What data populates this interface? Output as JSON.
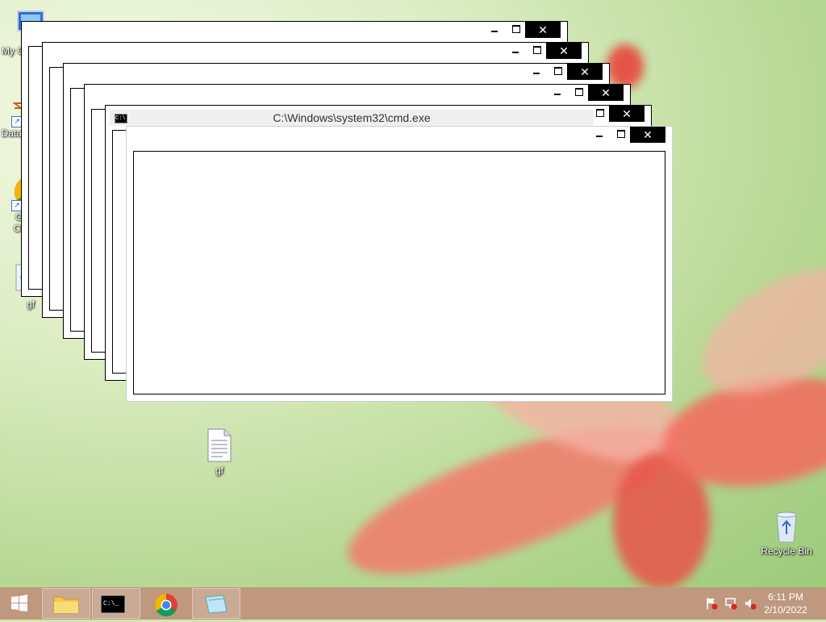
{
  "desktop": {
    "icons": [
      {
        "label": "My Computer",
        "icon": "computer-icon"
      },
      {
        "label": "DataWagon...",
        "icon": "datawagon-icon"
      },
      {
        "label": "Google Chrome",
        "icon": "chrome-icon"
      },
      {
        "label": "gf",
        "icon": "settings-file-icon"
      },
      {
        "label": "gf",
        "icon": "text-file-icon"
      },
      {
        "label": "Recycle Bin",
        "icon": "recycle-bin-icon"
      }
    ]
  },
  "window": {
    "title": "C:\\Windows\\system32\\cmd.exe",
    "close_glyph": "✕"
  },
  "taskbar": {
    "clock_time": "6:11 PM",
    "clock_date": "2/10/2022",
    "buttons": [
      "start-button",
      "file-explorer",
      "command-prompt",
      "google-chrome",
      "notepad"
    ]
  },
  "colors": {
    "taskbar": "#be9178",
    "titlebar_close": "#000000",
    "petal": "#f26a5c"
  }
}
